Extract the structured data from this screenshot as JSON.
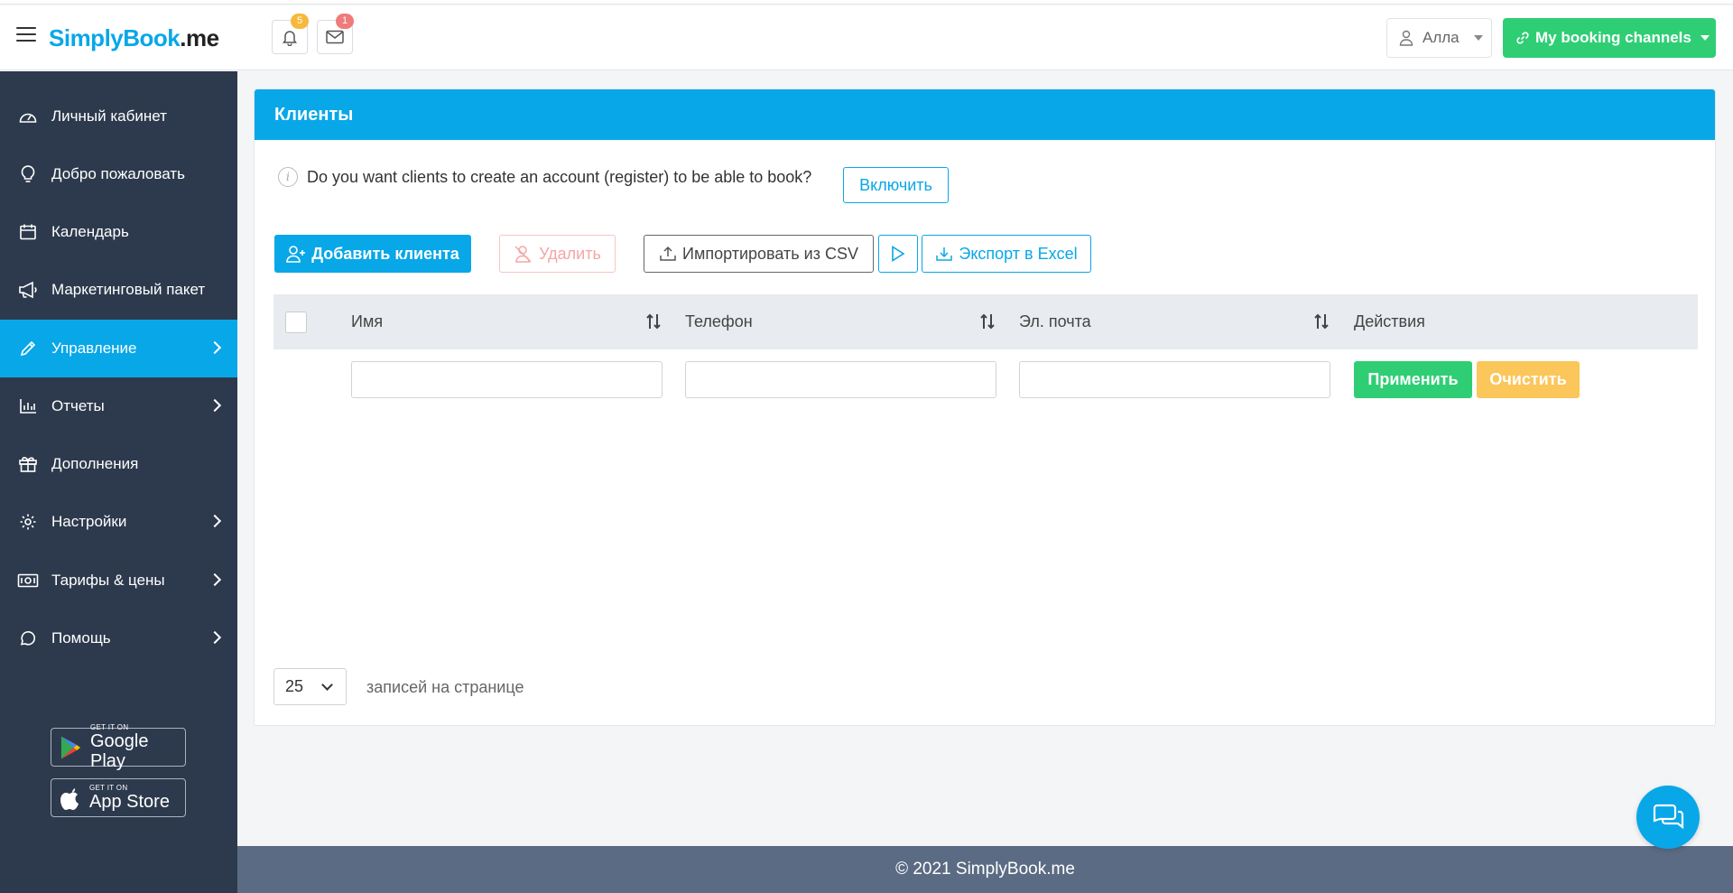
{
  "header": {
    "logo_brand": "SimplyBook",
    "logo_suffix": ".me",
    "notifications_count": "5",
    "messages_count": "1",
    "user_name": "Алла",
    "booking_channels_label": "My booking channels"
  },
  "sidebar": {
    "items": [
      {
        "label": "Личный кабинет",
        "icon": "dashboard-icon"
      },
      {
        "label": "Добро пожаловать",
        "icon": "lightbulb-icon"
      },
      {
        "label": "Календарь",
        "icon": "calendar-icon"
      },
      {
        "label": "Маркетинговый пакет",
        "icon": "megaphone-icon"
      },
      {
        "label": "Управление",
        "icon": "pencil-icon"
      },
      {
        "label": "Отчеты",
        "icon": "chart-icon"
      },
      {
        "label": "Дополнения",
        "icon": "gift-icon"
      },
      {
        "label": "Настройки",
        "icon": "gear-icon"
      },
      {
        "label": "Тарифы & цены",
        "icon": "money-icon"
      },
      {
        "label": "Помощь",
        "icon": "chat-icon"
      }
    ],
    "google_play": {
      "small": "GET IT ON",
      "big": "Google Play"
    },
    "app_store": {
      "small": "GET IT ON",
      "big": "App Store"
    }
  },
  "main": {
    "title": "Клиенты",
    "register_prompt": "Do you want clients to create an account (register) to be able to book?",
    "enable_label": "Включить",
    "add_client_label": "Добавить клиента",
    "delete_label": "Удалить",
    "import_label": "Импортировать из CSV",
    "export_label": "Экспорт в Excel",
    "table": {
      "columns": [
        "Имя",
        "Телефон",
        "Эл. почта",
        "Действия"
      ]
    },
    "filters": {
      "name_value": "",
      "phone_value": "",
      "email_value": ""
    },
    "apply_label": "Применить",
    "clear_label": "Очистить",
    "per_page_value": "25",
    "per_page_label": "записей на странице"
  },
  "footer": {
    "copyright": "© 2021 SimplyBook.me"
  },
  "colors": {
    "primary": "#08a7e8",
    "sidebar": "#2d3a4d",
    "success": "#2fce75",
    "warning": "#fbc65a",
    "footer": "#5b6b83"
  }
}
